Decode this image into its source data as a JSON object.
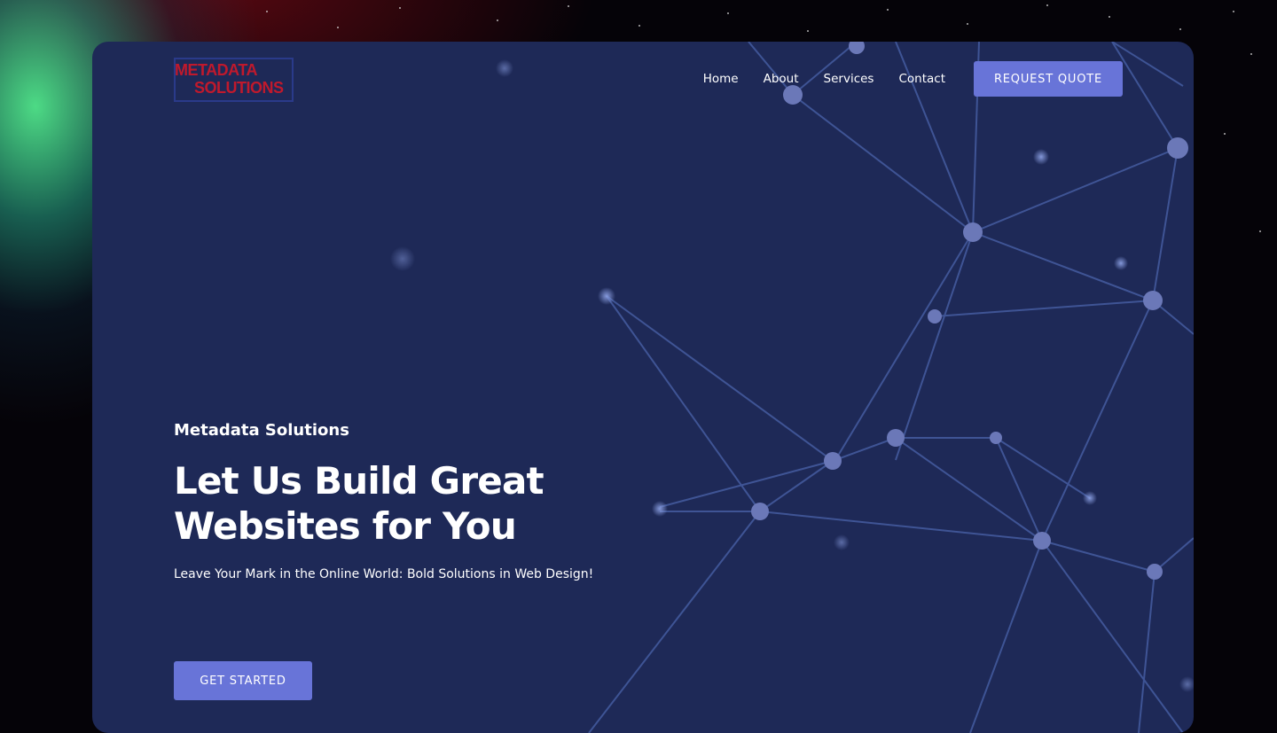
{
  "brand": {
    "logo_line1": "METADATA",
    "logo_line2": "SOLUTIONS",
    "logo_color": "#c0192c"
  },
  "nav": {
    "items": [
      {
        "label": "Home"
      },
      {
        "label": "About"
      },
      {
        "label": "Services"
      },
      {
        "label": "Contact"
      }
    ],
    "cta_label": "REQUEST QUOTE"
  },
  "hero": {
    "eyebrow": "Metadata Solutions",
    "title": "Let Us Build Great Websites for You",
    "subtitle": "Leave Your Mark in the Online World: Bold Solutions in Web Design!",
    "cta_label": "GET STARTED"
  },
  "colors": {
    "card_background": "#1e2957",
    "button": "#6874d8",
    "network_lines": "#5a78c8"
  }
}
